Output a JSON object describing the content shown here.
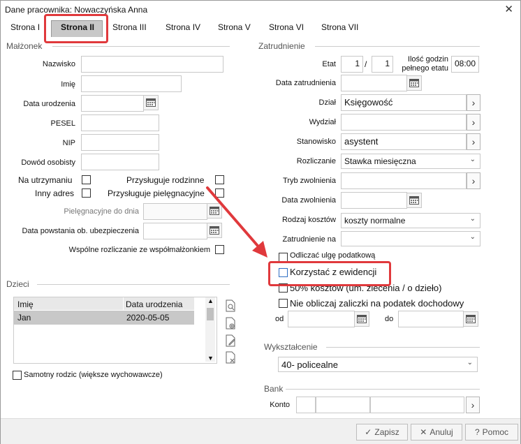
{
  "window": {
    "title": "Dane pracownika: Nowaczyńska Anna",
    "close": "✕"
  },
  "tabs": [
    "Strona I",
    "Strona II",
    "Strona III",
    "Strona IV",
    "Strona V",
    "Strona VI",
    "Strona VII"
  ],
  "spouse": {
    "section": "Małżonek",
    "surname_label": "Nazwisko",
    "firstname_label": "Imię",
    "birthdate_label": "Data urodzenia",
    "pesel_label": "PESEL",
    "nip_label": "NIP",
    "id_label": "Dowód osobisty",
    "dependent_label": "Na utrzymaniu",
    "other_address_label": "Inny adres",
    "family_allowance_label": "Przysługuje rodzinne",
    "care_allowance_label": "Przysługuje pielęgnacyjne",
    "care_until_label": "Pielęgnacyjne do dnia",
    "insurance_date_label": "Data powstania ob. ubezpieczenia",
    "joint_tax_label": "Wspólne rozliczanie ze współmałżonkiem"
  },
  "children": {
    "section": "Dzieci",
    "columns": [
      "Imię",
      "Data urodzenia"
    ],
    "rows": [
      {
        "name": "Jan",
        "birthdate": "2020-05-05"
      }
    ],
    "single_parent_label": "Samotny rodzic (większe wychowawcze)"
  },
  "employment": {
    "section": "Zatrudnienie",
    "etat_label": "Etat",
    "etat_num": "1",
    "etat_sep": "/",
    "etat_den": "1",
    "hours_label_1": "Ilość godzin",
    "hours_label_2": "pełnego etatu",
    "hours_value": "08:00",
    "hire_date_label": "Data zatrudnienia",
    "department_label": "Dział",
    "department_value": "Księgowość",
    "division_label": "Wydział",
    "position_label": "Stanowisko",
    "position_value": "asystent",
    "settlement_label": "Rozliczanie",
    "settlement_value": "Stawka miesięczna",
    "dismissal_mode_label": "Tryb zwolnienia",
    "dismissal_date_label": "Data zwolnienia",
    "cost_type_label": "Rodzaj kosztów",
    "cost_type_value": "koszty normalne",
    "employment_at_label": "Zatrudnienie na",
    "tax_relief_label": "Odliczać ulgę podatkową",
    "use_register_label": "Korzystać z ewidencji",
    "costs50_label": "50% kosztów (um. zlecenia / o dzieło)",
    "no_advance_label": "Nie obliczaj zaliczki na podatek dochodowy",
    "from_label": "od",
    "to_label": "do"
  },
  "education": {
    "section": "Wykształcenie",
    "value": "40- policealne"
  },
  "bank": {
    "section": "Bank",
    "account_label": "Konto"
  },
  "buttons": {
    "save": "Zapisz",
    "cancel": "Anuluj",
    "help": "Pomoc"
  },
  "icons": {
    "calendar": "calendar-icon",
    "chevron": "chevron-right-icon",
    "caret": "chevron-down-icon"
  }
}
